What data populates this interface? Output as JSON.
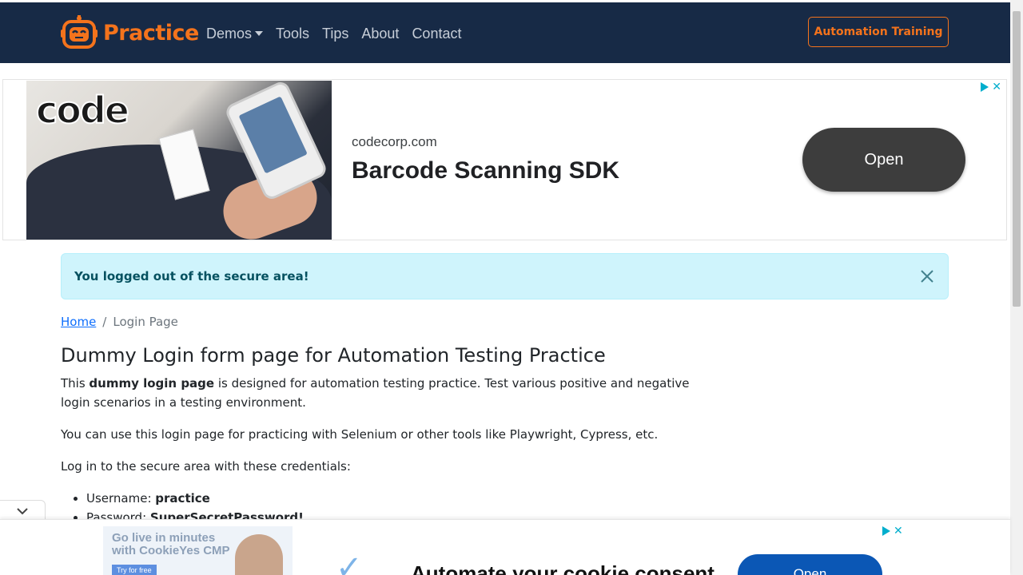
{
  "navbar": {
    "brand": "Practice",
    "links": [
      {
        "label": "Demos",
        "dropdown": true
      },
      {
        "label": "Tools"
      },
      {
        "label": "Tips"
      },
      {
        "label": "About"
      },
      {
        "label": "Contact"
      }
    ],
    "cta_label": "Automation Training",
    "colors": {
      "background": "#172a46",
      "accent": "#f4731c"
    }
  },
  "ad_top": {
    "image_logo": "code",
    "domain": "codecorp.com",
    "title": "Barcode Scanning SDK",
    "open_label": "Open"
  },
  "alert": {
    "message": "You logged out of the secure area!"
  },
  "breadcrumb": {
    "home": "Home",
    "separator": "/",
    "current": "Login Page"
  },
  "main": {
    "title": "Dummy Login form page for Automation Testing Practice",
    "intro_pre": "This ",
    "intro_bold": "dummy login page",
    "intro_post": " is designed for automation testing practice. Test various positive and negative login scenarios in a testing environment.",
    "tools_text": "You can use this login page for practicing with Selenium or other tools like Playwright, Cypress, etc.",
    "credentials_intro": "Log in to the secure area with these credentials:",
    "credentials": [
      {
        "label": "Username: ",
        "value": "practice"
      },
      {
        "label": "Password: ",
        "value": "SuperSecretPassword!"
      }
    ]
  },
  "ad_bottom": {
    "image_text": "Go live in minutes with CookieYes CMP",
    "image_button": "Try for free",
    "title": "Automate your cookie consent",
    "open_label": "Open"
  }
}
